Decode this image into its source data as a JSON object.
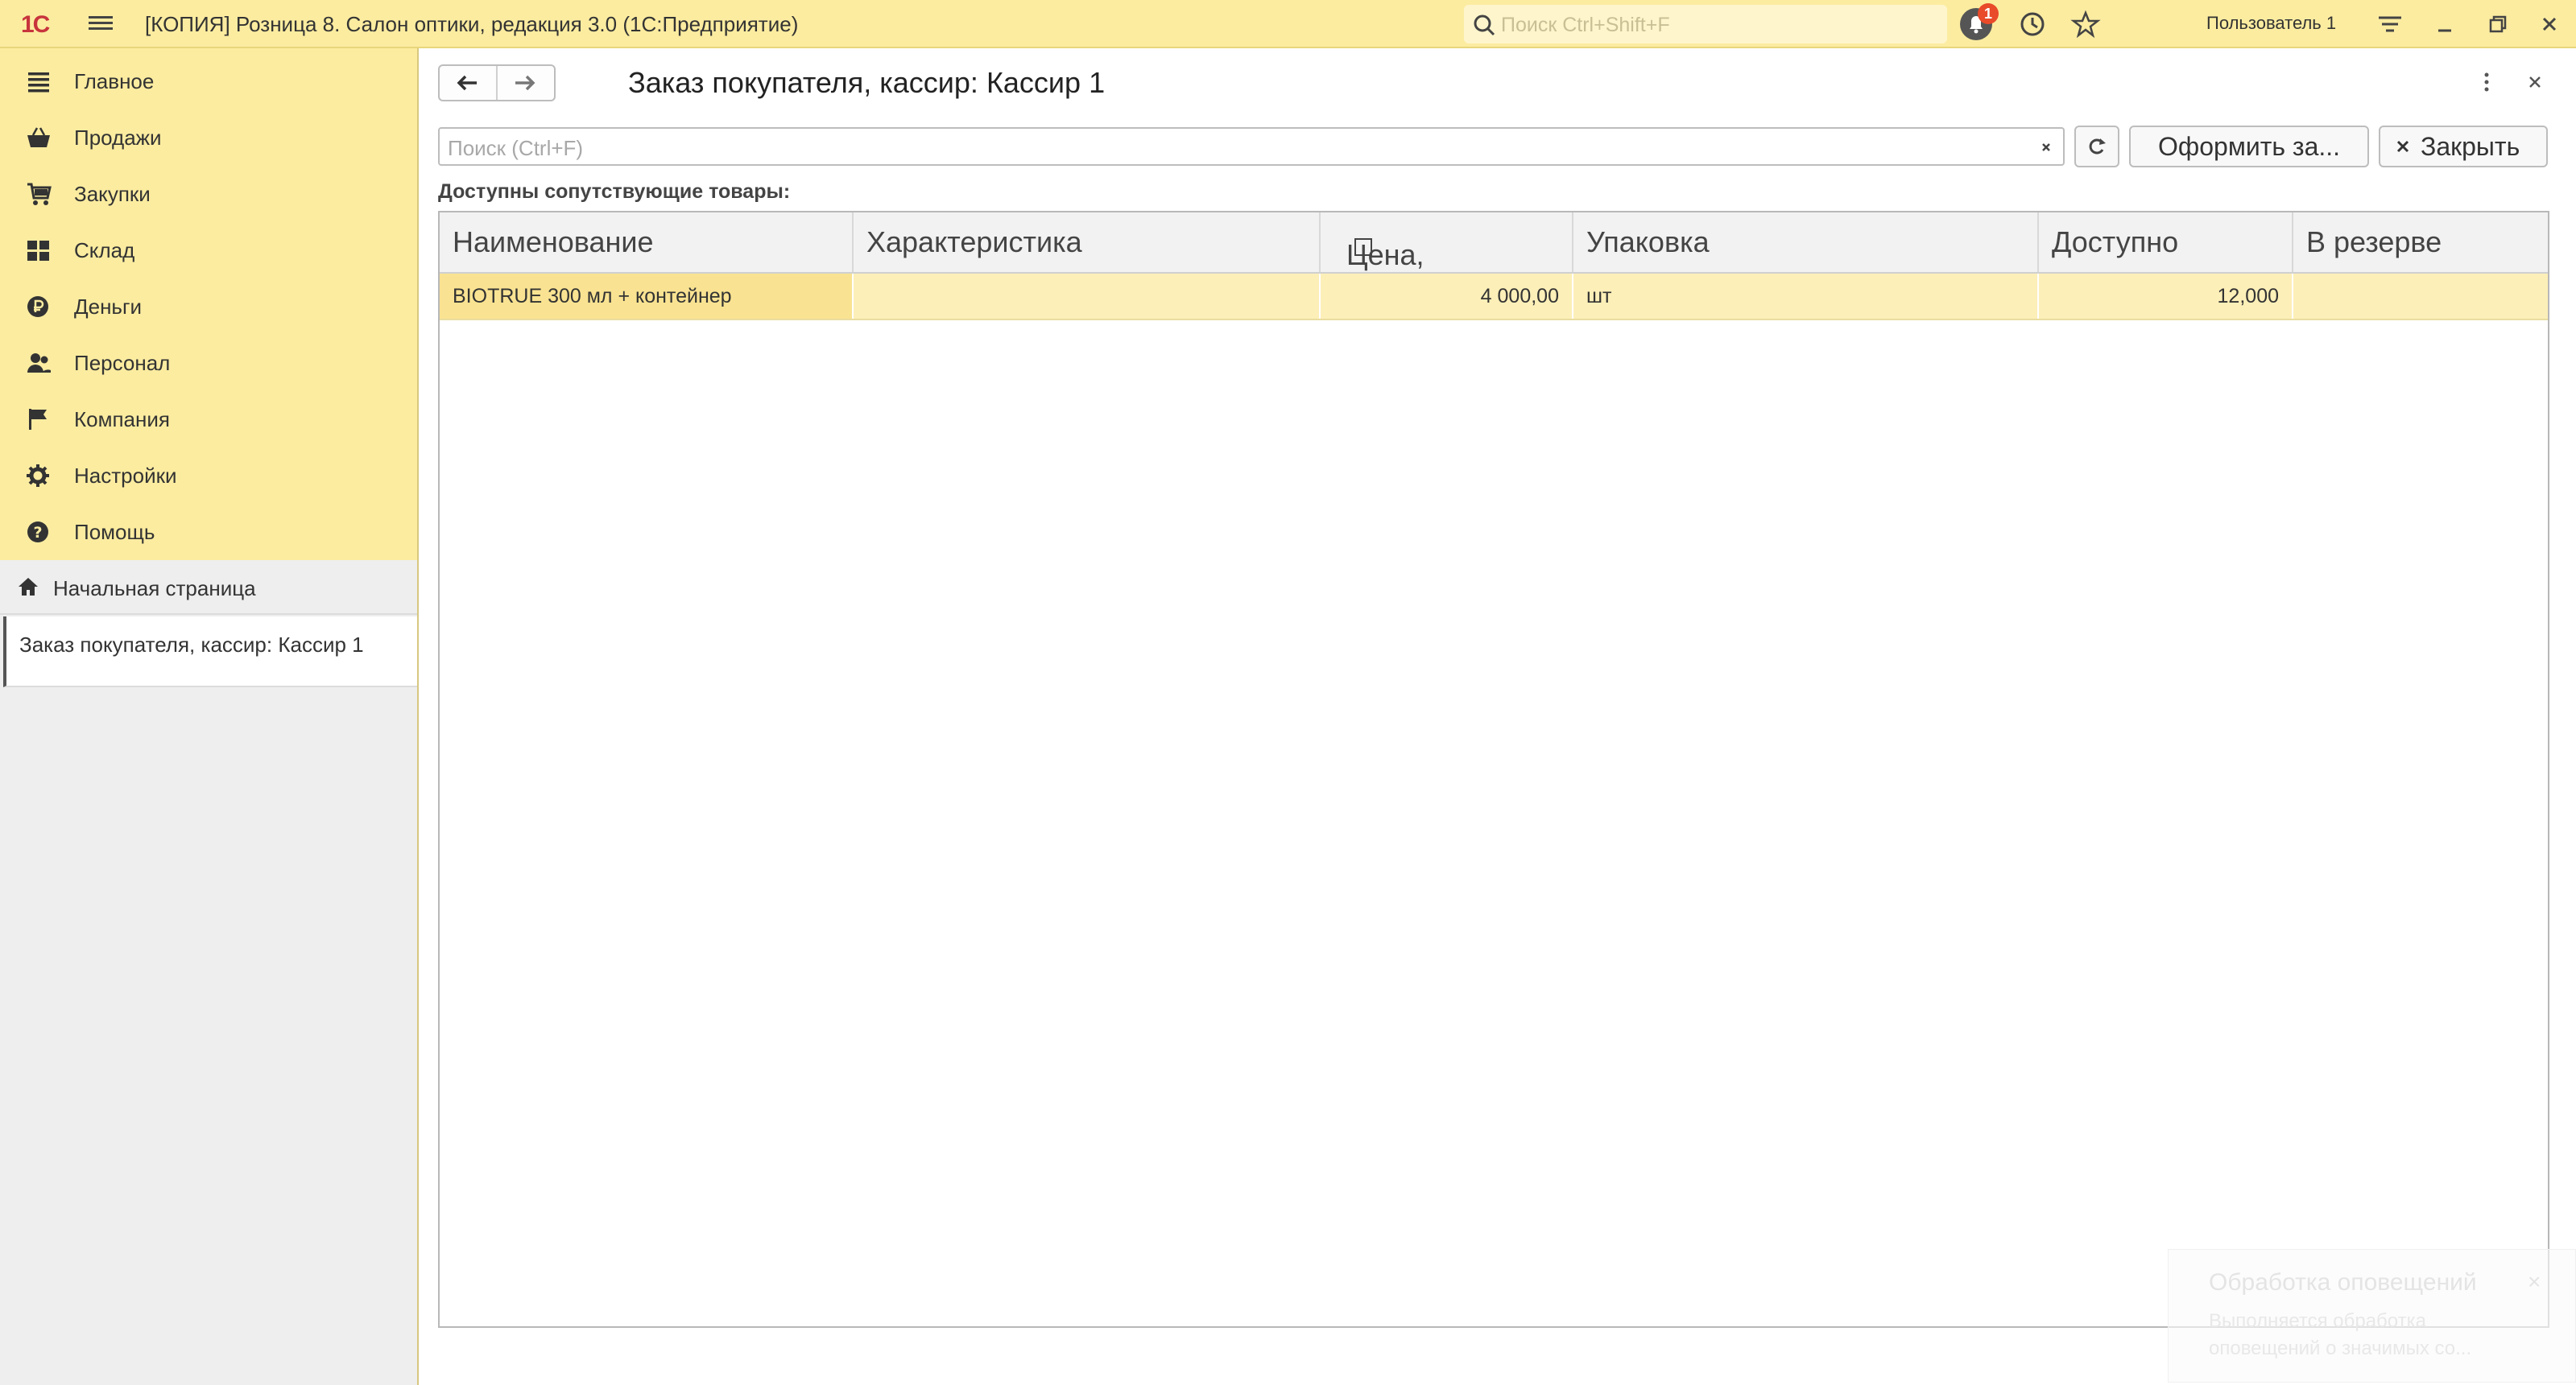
{
  "titlebar": {
    "app_title": "[КОПИЯ] Розница 8. Салон оптики, редакция 3.0  (1С:Предприятие)",
    "search_placeholder": "Поиск Ctrl+Shift+F",
    "notifications_count": "1",
    "user": "Пользователь 1"
  },
  "sidebar": {
    "items": [
      {
        "label": "Главное",
        "icon": "menu-lines-icon"
      },
      {
        "label": "Продажи",
        "icon": "basket-icon"
      },
      {
        "label": "Закупки",
        "icon": "cart-icon"
      },
      {
        "label": "Склад",
        "icon": "warehouse-grid-icon"
      },
      {
        "label": "Деньги",
        "icon": "ruble-icon"
      },
      {
        "label": "Персонал",
        "icon": "people-icon"
      },
      {
        "label": "Компания",
        "icon": "flag-icon"
      },
      {
        "label": "Настройки",
        "icon": "gear-icon"
      },
      {
        "label": "Помощь",
        "icon": "help-icon"
      }
    ],
    "home_label": "Начальная страница",
    "open_doc_label": "Заказ покупателя, кассир: Кассир 1"
  },
  "form": {
    "title": "Заказ покупателя, кассир: Кассир 1",
    "search_placeholder": "Поиск (Ctrl+F)",
    "order_button": "Оформить за...",
    "close_button": "Закрыть",
    "section_label": "Доступны сопутствующие товары:"
  },
  "table": {
    "columns": [
      "Наименование",
      "Характеристика",
      "Цена,",
      "Упаковка",
      "Доступно",
      "В резерве"
    ],
    "rows": [
      {
        "name": "BIOTRUE 300 мл + контейнер",
        "characteristic": "",
        "price": "4 000,00",
        "package": "шт",
        "available": "12,000",
        "reserved": ""
      }
    ]
  },
  "notification": {
    "title": "Обработка оповещений",
    "text": "Выполняется обработка оповещений о значимых со..."
  },
  "colors": {
    "titlebar_bg": "#fbeca0",
    "sidebar_bg": "#fbeca0",
    "row_highlight": "#fcefb8",
    "selected_cell": "#f9e392",
    "badge": "#e84a2a"
  }
}
